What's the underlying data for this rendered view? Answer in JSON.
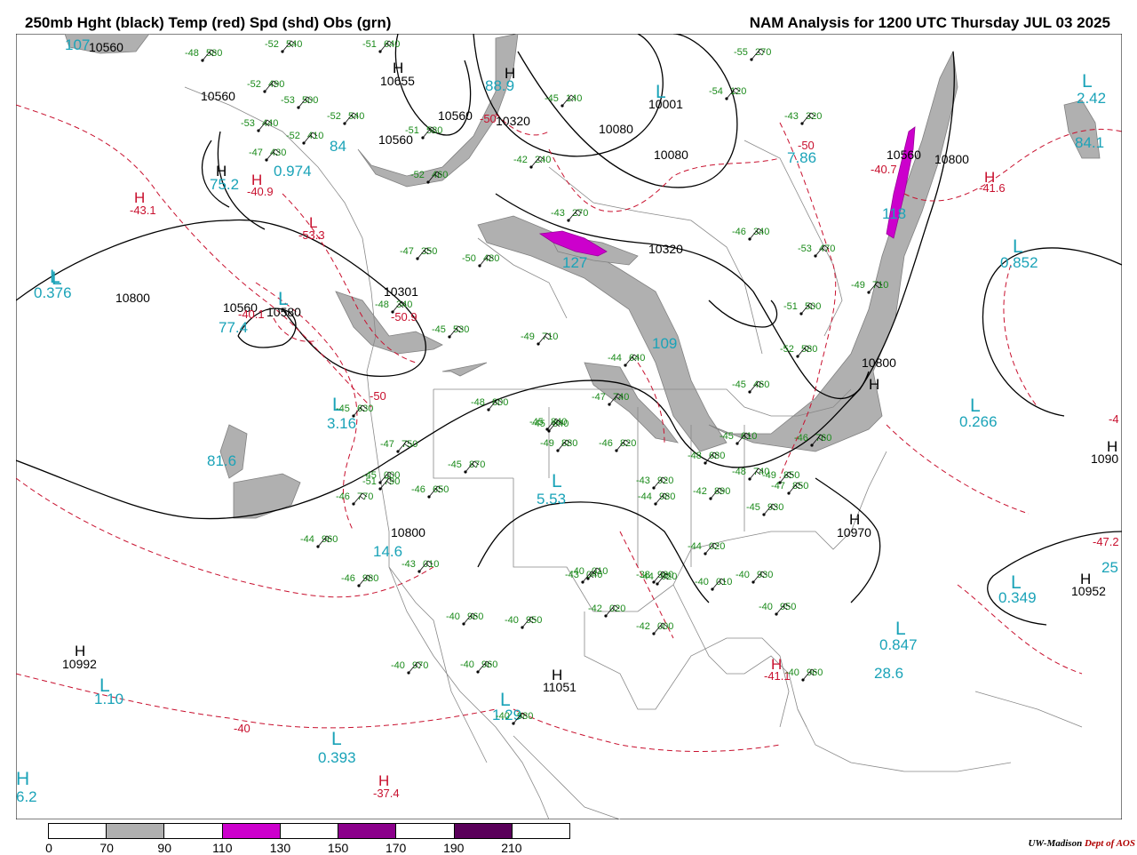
{
  "header": {
    "title_left": "250mb Hght (black) Temp (red) Spd (shd) Obs (grn)",
    "title_right": "NAM Analysis for 1200 UTC Thursday  JUL 03 2025"
  },
  "legend": {
    "ticks": [
      "0",
      "70",
      "90",
      "110",
      "130",
      "150",
      "170",
      "190",
      "210"
    ],
    "colors": [
      "#ffffff",
      "#b0b0b0",
      "#ffffff",
      "#cc00cc",
      "#ffffff",
      "#8b008b",
      "#ffffff",
      "#5a005a",
      "#ffffff"
    ]
  },
  "credit": {
    "org": "UW-Madison",
    "dept": "Dept of AOS"
  },
  "colors": {
    "height_contour": "#000000",
    "temperature_contour": "#c8102e",
    "speed_shade_70": "#b0b0b0",
    "speed_shade_110": "#cc00cc",
    "obs": "#1a8a1a",
    "speed_label": "#1aa3b8",
    "map_borders": "#888888"
  },
  "height_labels": [
    "10560",
    "10560",
    "10655",
    "10560",
    "10560",
    "10320",
    "10080",
    "10001",
    "10080",
    "10320",
    "10560",
    "10800",
    "10800",
    "10301",
    "10560",
    "10580",
    "10800",
    "10800",
    "10970",
    "10952",
    "10992",
    "11051",
    "1090"
  ],
  "height_marks": [
    "H",
    "H",
    "H",
    "H",
    "H",
    "H",
    "H",
    "H",
    "H"
  ],
  "speed_labels": [
    "107",
    "88.9",
    "84",
    "0.974",
    "75.2",
    "7.86",
    "118",
    "84.1",
    "2.42",
    "127",
    "0.852",
    "0.376",
    "77.4",
    "109",
    "3.16",
    "0.266",
    "81.6",
    "5.53",
    "14.6",
    "0.349",
    "25",
    "0.847",
    "28.6",
    "1.10",
    "1.29",
    "0.393",
    "6.2"
  ],
  "speed_marks": [
    "L",
    "L",
    "L",
    "L",
    "L",
    "L",
    "L",
    "L",
    "L",
    "L",
    "L",
    "L",
    "L",
    "L",
    "H"
  ],
  "temp_labels": [
    "-43.1",
    "-40.9",
    "-53.3",
    "-50",
    "-40.7",
    "-41.6",
    "-50.9",
    "-40.1",
    "-50",
    "-50",
    "-40",
    "-41.1",
    "-37.4",
    "-47.2",
    "-4"
  ],
  "temp_marks": [
    "H",
    "H",
    "L",
    "H",
    "H",
    "H"
  ],
  "obs_temps": [
    "-48",
    "-52",
    "-51",
    "-52",
    "-53",
    "-53",
    "-52",
    "-47",
    "-52",
    "-51",
    "-52",
    "-45",
    "-42",
    "-43",
    "-46",
    "-55",
    "-54",
    "-43",
    "-53",
    "-51",
    "-52",
    "-49",
    "-47",
    "-50",
    "-48",
    "-45",
    "-49",
    "-44",
    "-47",
    "-45",
    "-47",
    "-51",
    "-46",
    "-46",
    "-48",
    "-45",
    "-45",
    "-49",
    "-46",
    "-45",
    "-45",
    "-48",
    "-47",
    "-48",
    "-49",
    "-46",
    "-45",
    "-43",
    "-42",
    "-45",
    "-44",
    "-46",
    "-45",
    "-43",
    "-44",
    "-44",
    "-40",
    "-40",
    "-44",
    "-43",
    "-42",
    "-42",
    "-40",
    "-40",
    "-40",
    "-40",
    "-40",
    "-38",
    "-40",
    "-40",
    "-40",
    "-39",
    "-40",
    "-40",
    "-42",
    "-43",
    "-43",
    "-44",
    "-44",
    "-46",
    "-43"
  ],
  "obs_heights": [
    "580",
    "540",
    "640",
    "490",
    "500",
    "440",
    "410",
    "430",
    "540",
    "580",
    "460",
    "140",
    "240",
    "270",
    "340",
    "270",
    "120",
    "320",
    "470",
    "500",
    "580",
    "710",
    "350",
    "480",
    "340",
    "530",
    "710",
    "640",
    "740",
    "630",
    "750",
    "790",
    "770",
    "650",
    "800",
    "840",
    "870",
    "880",
    "820",
    "460",
    "610",
    "680",
    "850",
    "740",
    "850",
    "760",
    "840",
    "920",
    "890",
    "930",
    "960",
    "980",
    "000",
    "010",
    "980",
    "020",
    "010",
    "010",
    "020",
    "040",
    "020",
    "000",
    "960",
    "950",
    "970",
    "960",
    "980",
    "980",
    "930",
    "950",
    "960"
  ]
}
